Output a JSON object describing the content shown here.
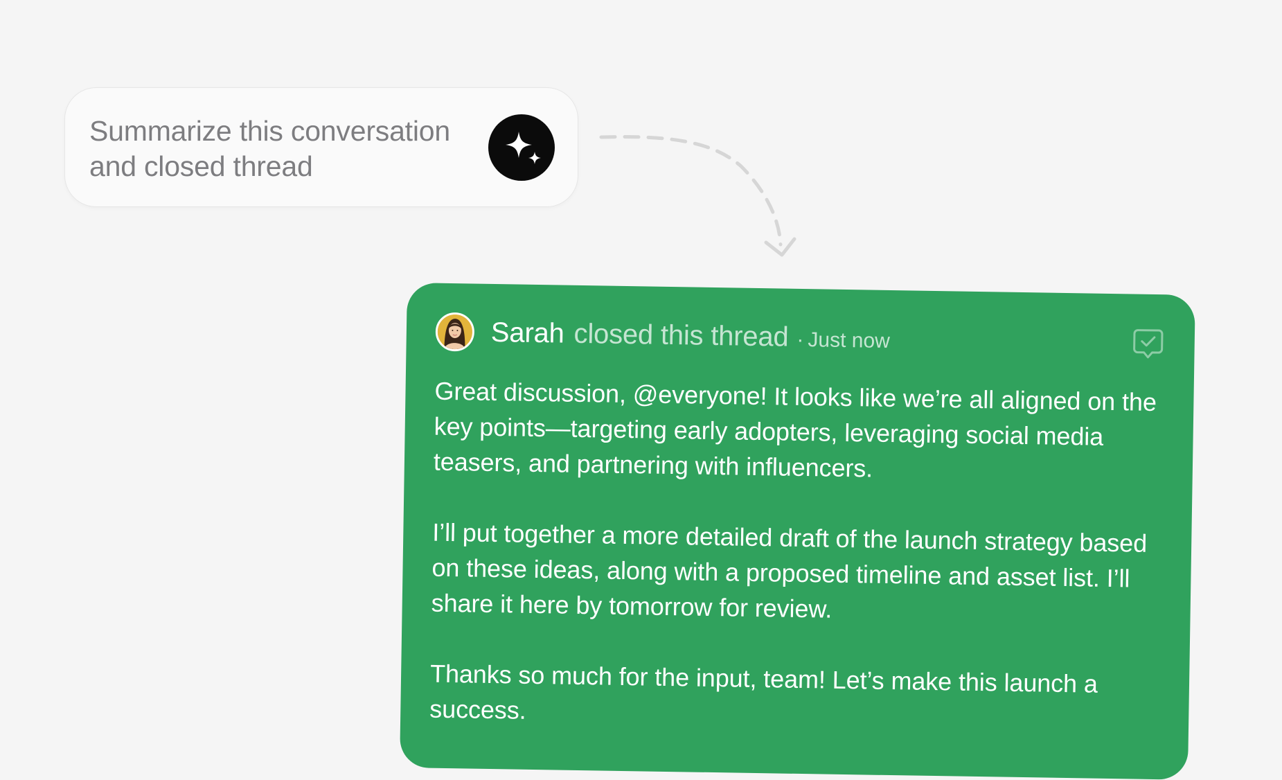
{
  "prompt": {
    "text": "Summarize this conversation\nand closed thread",
    "button_icon": "sparkle-icon"
  },
  "thread": {
    "author": "Sarah",
    "action": "closed this thread",
    "separator": "·",
    "timestamp": "Just now",
    "status_icon": "resolved-comment-icon",
    "card_color": "#30a25d",
    "paragraphs": [
      "Great discussion, @everyone! It looks like we’re all aligned on the key points—targeting early adopters, leveraging social media teasers, and partnering with influencers.",
      "I’ll put together a more detailed draft of the launch strategy based on these ideas, along with a proposed timeline and asset list. I’ll share it here by tomorrow for review.",
      "Thanks so much for the input, team! Let’s make this launch a success."
    ]
  }
}
